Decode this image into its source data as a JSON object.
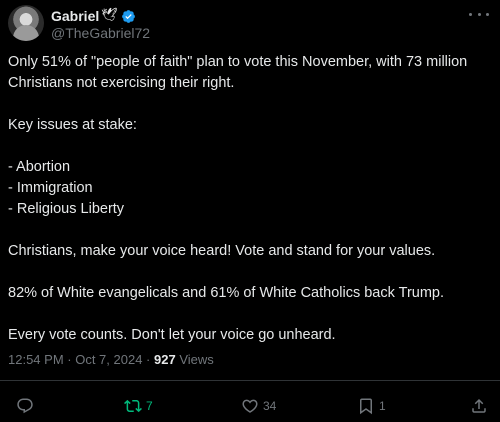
{
  "author": {
    "display_name": "Gabriel",
    "dove_glyph": "🕊",
    "handle": "@TheGabriel72",
    "verified_color": "#1d9bf0"
  },
  "tweet": {
    "lines": [
      "Only 51% of \"people of faith\" plan to vote this November, with 73 million Christians not exercising their right.",
      "",
      "Key issues at stake:",
      "",
      "- Abortion",
      "- Immigration",
      "- Religious Liberty",
      "",
      "Christians, make your voice heard! Vote and stand for your values.",
      "",
      "82% of White evangelicals and 61% of White Catholics back Trump.",
      "",
      "Every vote counts. Don't let your voice go unheard."
    ]
  },
  "meta": {
    "time": "12:54 PM",
    "separator": " · ",
    "date": "Oct 7, 2024",
    "views_count": "927",
    "views_label": " Views"
  },
  "actions": {
    "reply_icon": "reply-icon",
    "retweet_icon": "retweet-icon",
    "retweet_count": "7",
    "retweet_color": "#00ba7c",
    "like_icon": "heart-icon",
    "like_count": "34",
    "bookmark_icon": "bookmark-icon",
    "bookmark_count": "1",
    "share_icon": "share-icon"
  }
}
